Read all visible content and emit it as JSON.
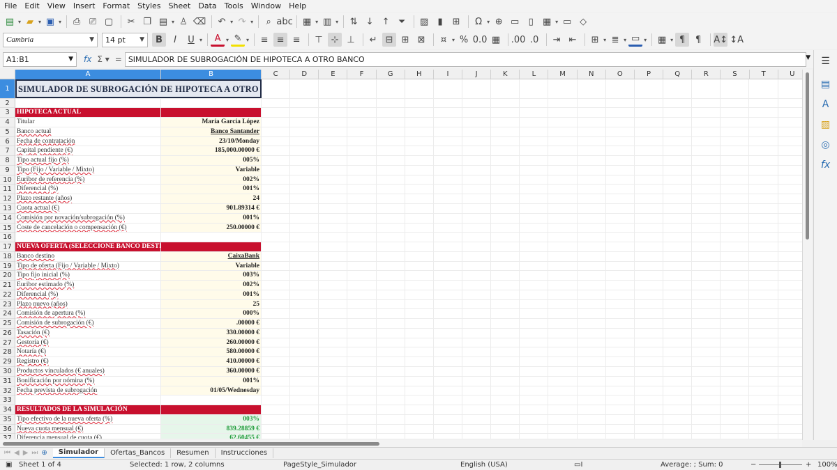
{
  "menu": [
    "File",
    "Edit",
    "View",
    "Insert",
    "Format",
    "Styles",
    "Sheet",
    "Data",
    "Tools",
    "Window",
    "Help"
  ],
  "format_toolbar": {
    "font_name": "Cambria",
    "font_size": "14 pt"
  },
  "formula_bar": {
    "name_box": "A1:B1",
    "formula": "SIMULADOR DE SUBROGACIÓN DE HIPOTECA A OTRO BANCO"
  },
  "columns": [
    "A",
    "B",
    "C",
    "D",
    "E",
    "F",
    "G",
    "H",
    "I",
    "J",
    "K",
    "L",
    "M",
    "N",
    "O",
    "P",
    "Q",
    "R",
    "S",
    "T",
    "U"
  ],
  "rows": [
    {
      "n": "1",
      "a": "SIMULADOR DE SUBROGACIÓN DE HIPOTECA A OTRO BANCO",
      "b": "",
      "style": "title"
    },
    {
      "n": "2",
      "a": "",
      "b": ""
    },
    {
      "n": "3",
      "a": "HIPOTECA ACTUAL",
      "b": "",
      "style": "sec"
    },
    {
      "n": "4",
      "a": "Titular",
      "b": "María García López",
      "u": false
    },
    {
      "n": "5",
      "a": "Banco actual",
      "b": "Banco Santander",
      "u": true
    },
    {
      "n": "6",
      "a": "Fecha de contratación",
      "b": "23/10/Monday",
      "u": true
    },
    {
      "n": "7",
      "a": "Capital pendiente (€)",
      "b": "185,000.00000 €",
      "u": true
    },
    {
      "n": "8",
      "a": "Tipo actual fijo (%)",
      "b": "005%",
      "u": true
    },
    {
      "n": "9",
      "a": "Tipo (Fijo / Variable / Mixto)",
      "b": "Variable",
      "u": true
    },
    {
      "n": "10",
      "a": "Euribor de referencia (%)",
      "b": "002%",
      "u": true
    },
    {
      "n": "11",
      "a": "Diferencial (%)",
      "b": "001%",
      "u": true
    },
    {
      "n": "12",
      "a": "Plazo restante (años)",
      "b": "24",
      "u": true
    },
    {
      "n": "13",
      "a": "Cuota actual (€)",
      "b": "901.89314 €",
      "u": true
    },
    {
      "n": "14",
      "a": "Comisión por novación/subrogación (%)",
      "b": "001%",
      "u": true
    },
    {
      "n": "15",
      "a": "Coste de cancelación o compensación (€)",
      "b": "250.00000 €",
      "u": true
    },
    {
      "n": "16",
      "a": "",
      "b": ""
    },
    {
      "n": "17",
      "a": "NUEVA OFERTA (SELECCIONE BANCO DESTINO)",
      "b": "",
      "style": "sec"
    },
    {
      "n": "18",
      "a": "Banco destino",
      "b": "CaixaBank",
      "u": true
    },
    {
      "n": "19",
      "a": "Tipo de oferta (Fijo / Variable / Mixto)",
      "b": "Variable",
      "u": true
    },
    {
      "n": "20",
      "a": "Tipo fijo inicial (%)",
      "b": "003%",
      "u": true
    },
    {
      "n": "21",
      "a": "Euribor estimado (%)",
      "b": "002%",
      "u": true
    },
    {
      "n": "22",
      "a": "Diferencial (%)",
      "b": "001%",
      "u": true
    },
    {
      "n": "23",
      "a": "Plazo nuevo (años)",
      "b": "25",
      "u": true
    },
    {
      "n": "24",
      "a": "Comisión de apertura (%)",
      "b": "000%",
      "u": true
    },
    {
      "n": "25",
      "a": "Comisión de subrogación (€)",
      "b": ".00000 €",
      "u": true
    },
    {
      "n": "26",
      "a": "Tasación (€)",
      "b": "330.00000 €",
      "u": true
    },
    {
      "n": "27",
      "a": "Gestoría (€)",
      "b": "260.00000 €",
      "u": true
    },
    {
      "n": "28",
      "a": "Notaría (€)",
      "b": "580.00000 €",
      "u": true
    },
    {
      "n": "29",
      "a": "Registro (€)",
      "b": "410.00000 €",
      "u": true
    },
    {
      "n": "30",
      "a": "Productos vinculados (€ anuales)",
      "b": "360.00000 €",
      "u": true
    },
    {
      "n": "31",
      "a": "Bonificación por nómina (%)",
      "b": "001%",
      "u": true
    },
    {
      "n": "32",
      "a": "Fecha prevista de subrogación",
      "b": "01/05/Wednesday",
      "u": true
    },
    {
      "n": "33",
      "a": "",
      "b": ""
    },
    {
      "n": "34",
      "a": "RESULTADOS DE LA SIMULACIÓN",
      "b": "",
      "style": "sec"
    },
    {
      "n": "35",
      "a": "Tipo efectivo de la nueva oferta (%)",
      "b": "003%",
      "u": true,
      "style": "green"
    },
    {
      "n": "36",
      "a": "Nueva cuota mensual (€)",
      "b": "839.28859 €",
      "u": true,
      "style": "green"
    },
    {
      "n": "37",
      "a": "Diferencia mensual de cuota (€)",
      "b": "62.60455 €",
      "u": true,
      "style": "green"
    }
  ],
  "sheet_tabs": [
    "Simulador",
    "Ofertas_Bancos",
    "Resumen",
    "Instrucciones"
  ],
  "active_tab": "Simulador",
  "status": {
    "sheet": "Sheet 1 of 4",
    "selection": "Selected: 1 row, 2 columns",
    "page_style": "PageStyle_Simulador",
    "language": "English (USA)",
    "summary": "Average: ; Sum: 0",
    "zoom": "100%"
  },
  "colors": {
    "section_red": "#c8102e",
    "selection_blue": "#3c8de0",
    "result_green": "#1f9a3a"
  }
}
